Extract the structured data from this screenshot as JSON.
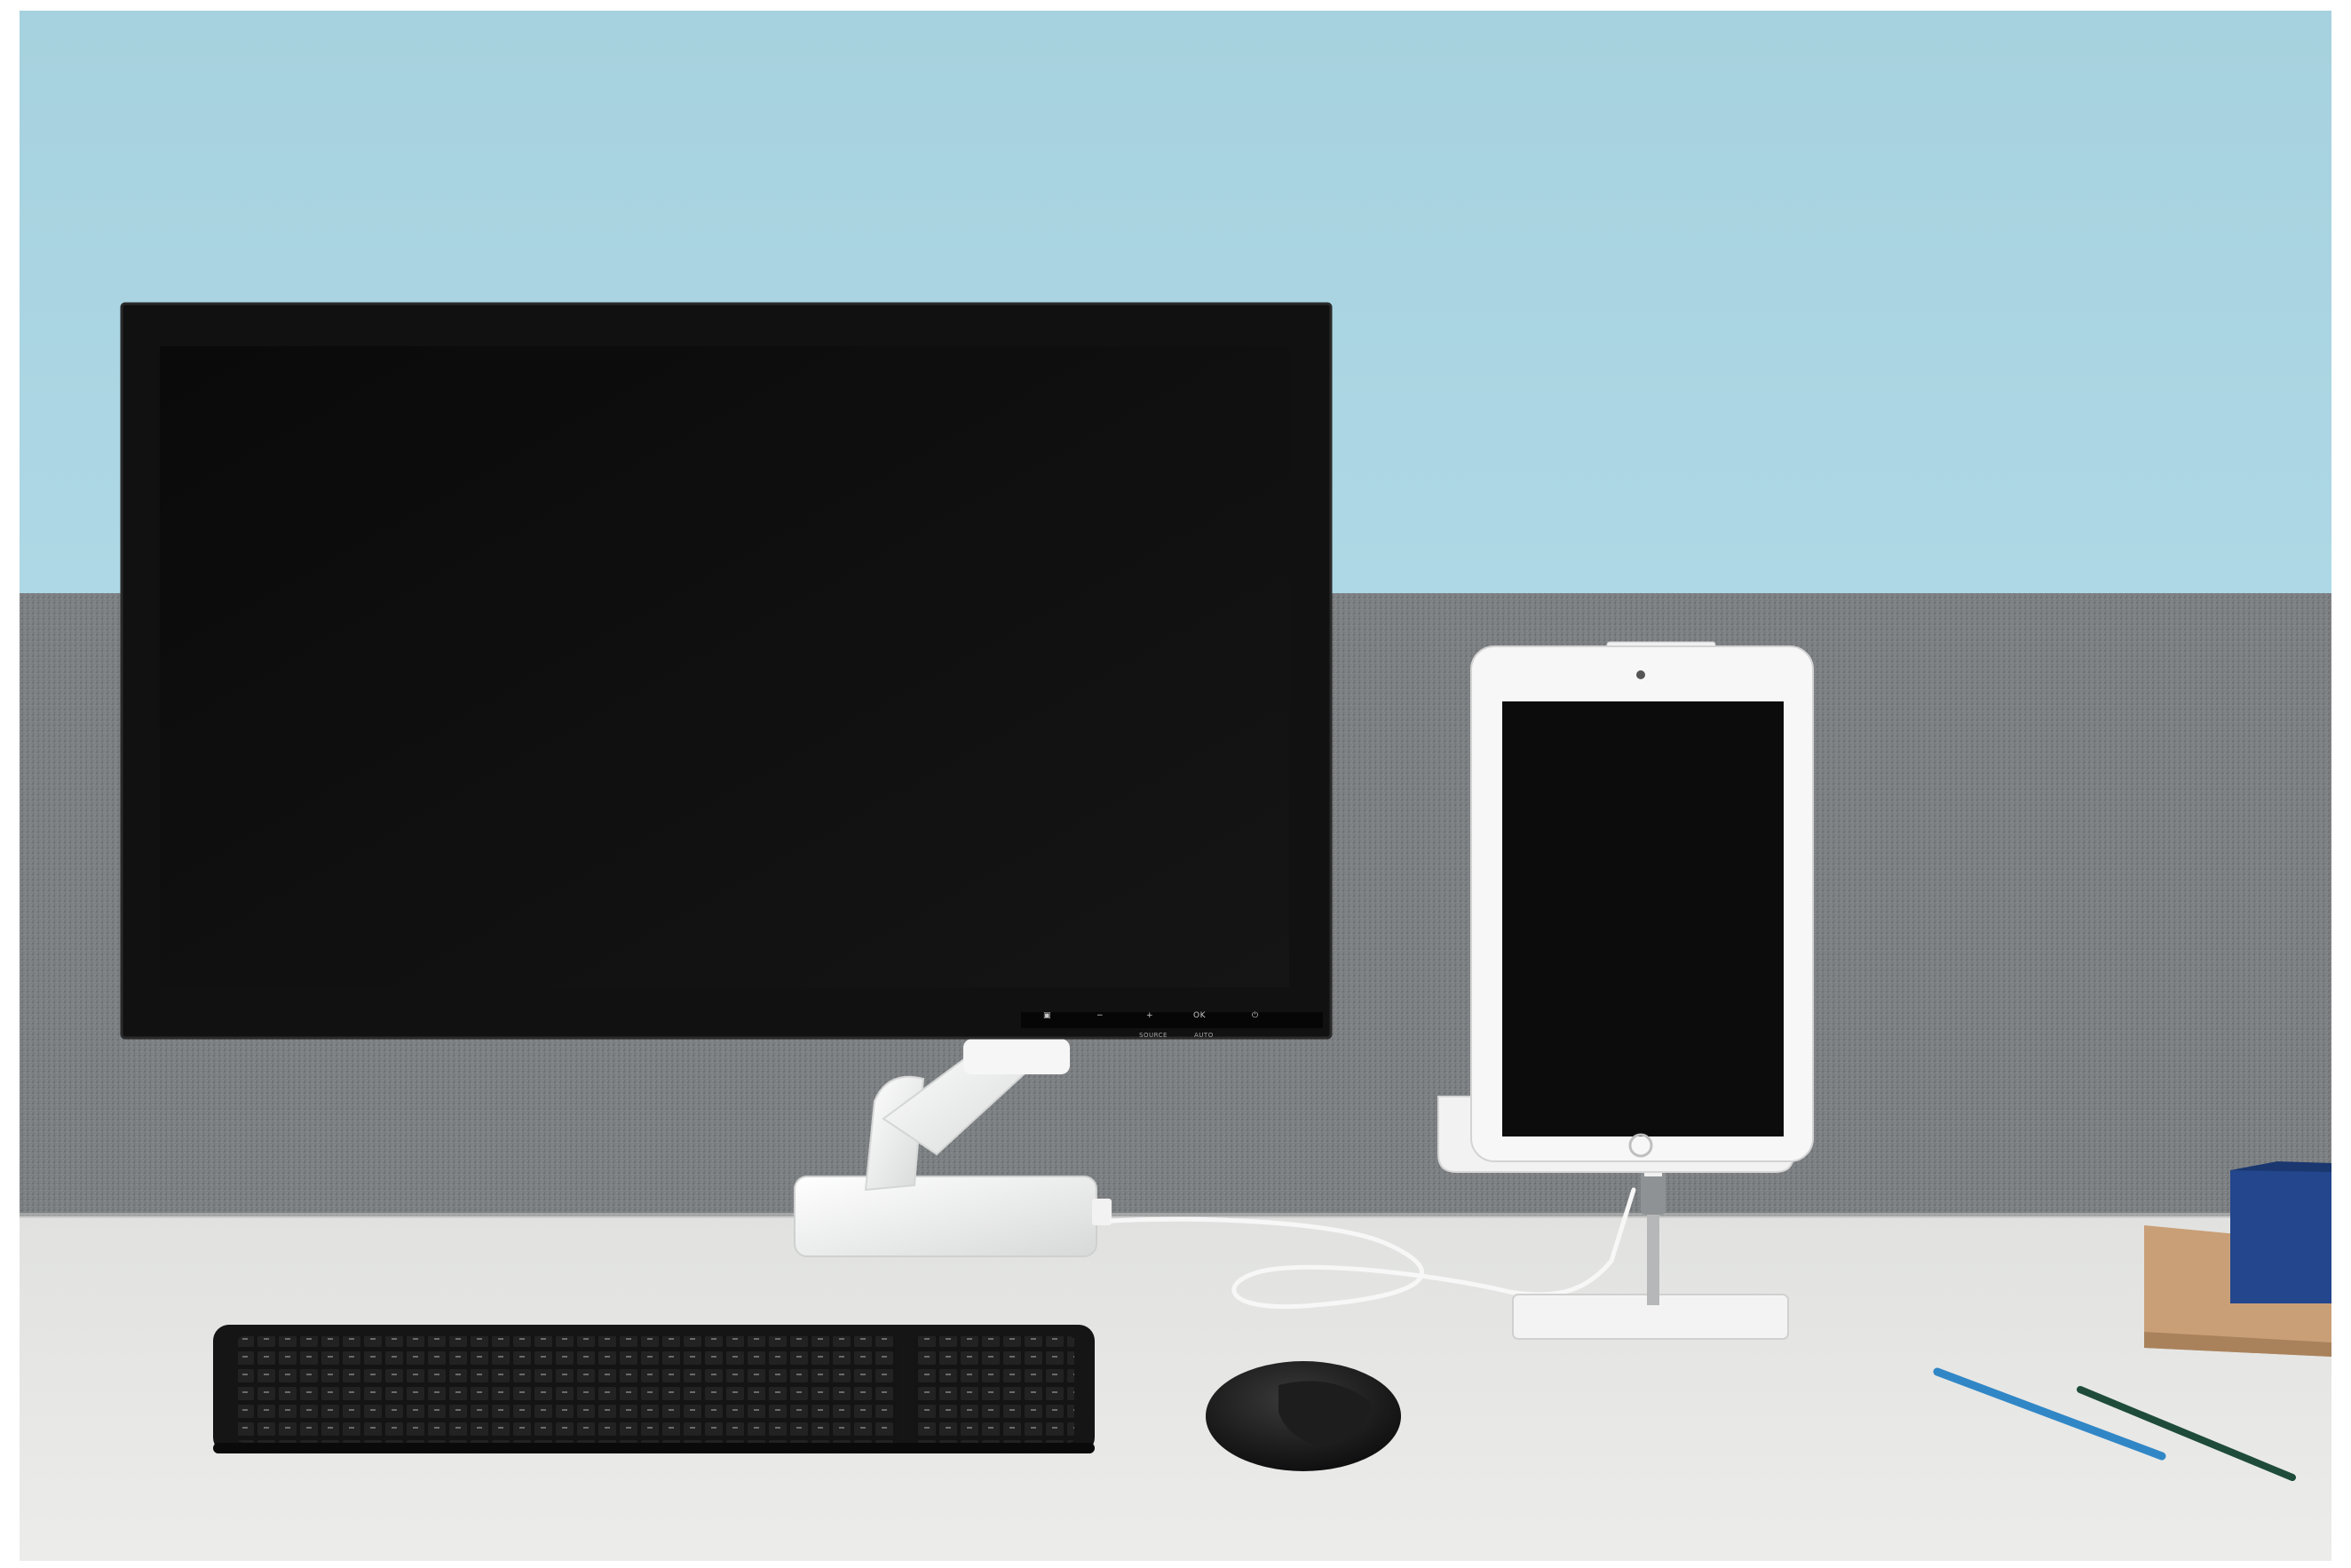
{
  "photo": {
    "subject": "desk-workstation",
    "colors": {
      "wall": "#a9d3df",
      "panel": "#7b7e81",
      "desk": "#e7e8e6",
      "monitor": "#101010",
      "keyboard": "#151515",
      "tablet_frame": "#f4f4f4",
      "book_blue": "#23468c",
      "book_tan": "#c99f77",
      "pencil_blue": "#3187c6",
      "pencil_green": "#1f4c3a"
    }
  },
  "monitor_controls": {
    "buttons": [
      "▣",
      "−",
      "+",
      "OK",
      "⏻"
    ],
    "captions": [
      "SOURCE",
      "AUTO"
    ]
  }
}
